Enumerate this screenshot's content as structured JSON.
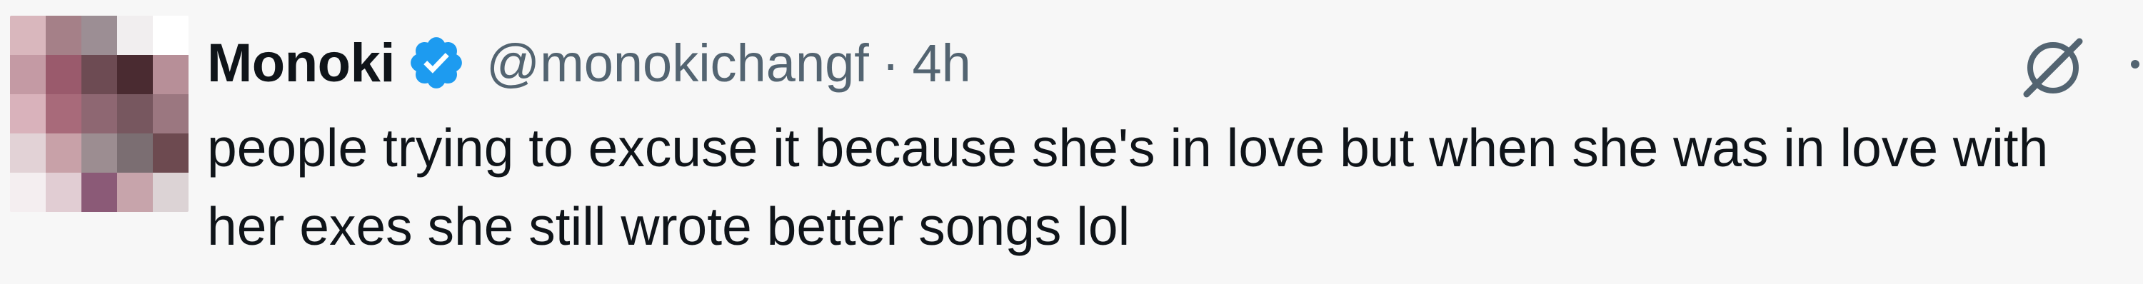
{
  "tweet": {
    "display_name": "Monoki",
    "handle": "@monokichangf",
    "separator": "·",
    "time": "4h",
    "text": "people trying to excuse it because she's in love but when she was in love with her exes she still wrote better songs lol"
  },
  "icons": {
    "verified": "verified-badge-icon",
    "grok": "grok-icon",
    "more": "more-icon"
  },
  "colors": {
    "background": "#f7f7f7",
    "text_primary": "#0f1419",
    "text_secondary": "#536471",
    "verified_blue": "#1d9bf0"
  },
  "avatar": {
    "pixels": [
      "#d9b7bd",
      "#a58088",
      "#9c8e94",
      "#f1eeef",
      "#ffffff",
      "#c49aa4",
      "#9a5a6c",
      "#6d4b53",
      "#4a2b31",
      "#b78f98",
      "#d9b2bb",
      "#a86a7a",
      "#8e6772",
      "#77575f",
      "#9b7780",
      "#e2d2d6",
      "#c8a1a8",
      "#9c8d91",
      "#7b6e72",
      "#6d4a50",
      "#f4eef0",
      "#e1cdd3",
      "#8b5a77",
      "#c7a4ab",
      "#dcd3d5"
    ]
  }
}
